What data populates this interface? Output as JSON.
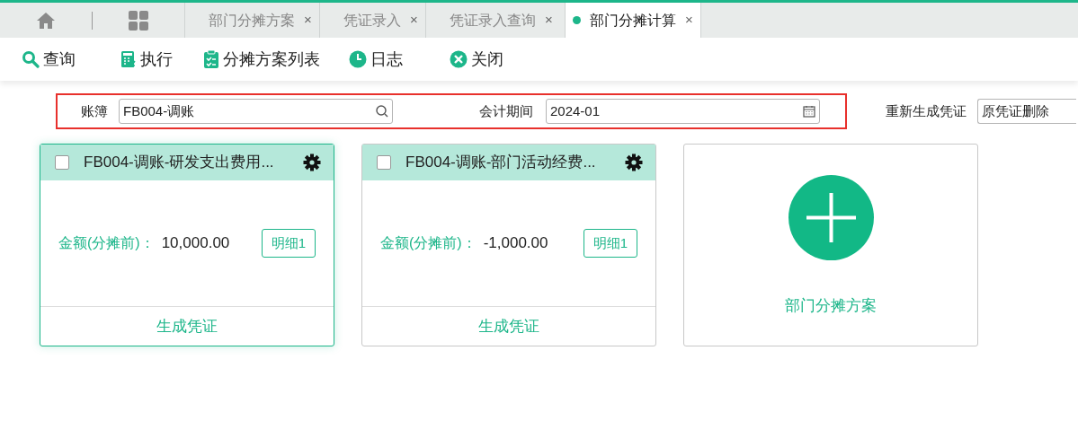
{
  "tabs": [
    {
      "label": "部门分摊方案",
      "selected": false,
      "close": "×"
    },
    {
      "label": "凭证录入",
      "selected": false,
      "close": "×"
    },
    {
      "label": "凭证录入查询",
      "selected": false,
      "close": "×"
    },
    {
      "label": "部门分摊计算",
      "selected": true,
      "close": "×"
    }
  ],
  "toolbar": [
    {
      "label": "查询",
      "kind": "search"
    },
    {
      "label": "执行",
      "kind": "calc"
    },
    {
      "label": "分摊方案列表",
      "kind": "clipboard"
    },
    {
      "label": "日志",
      "kind": "clock"
    },
    {
      "label": "关闭",
      "kind": "close"
    }
  ],
  "filters": {
    "highlighted": true,
    "ledger_label": "账簿",
    "ledger_value": "FB004-调账",
    "period_label": "会计期间",
    "period_value": "2024-01"
  },
  "regenerate": {
    "label": "重新生成凭证",
    "value": "原凭证删除"
  },
  "cards": [
    {
      "title": "FB004-调账-研发支出费用...",
      "selected": true,
      "checked": false,
      "amount_label": "金额(分摊前)：",
      "amount": "10,000.00",
      "detail": "明细1",
      "action": "生成凭证"
    },
    {
      "title": "FB004-调账-部门活动经费...",
      "selected": false,
      "checked": false,
      "amount_label": "金额(分摊前)：",
      "amount": "-1,000.00",
      "detail": "明细1",
      "action": "生成凭证"
    }
  ],
  "add_card": {
    "label": "部门分摊方案"
  }
}
